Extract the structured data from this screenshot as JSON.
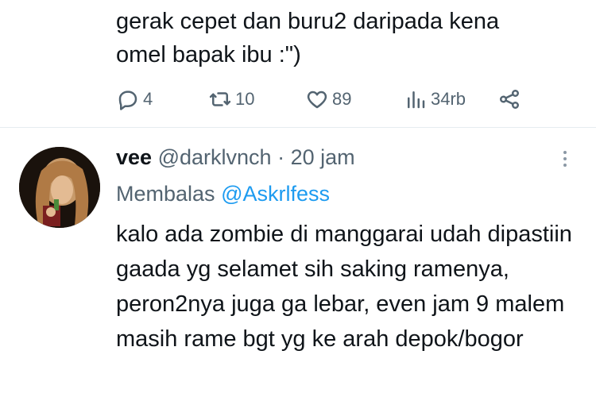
{
  "top_tweet": {
    "text": "gerak cepet dan buru2 daripada kena\nomel bapak ibu :\")",
    "actions": {
      "replies": "4",
      "retweets": "10",
      "likes": "89",
      "views": "34rb"
    },
    "icons": [
      "reply-icon",
      "retweet-icon",
      "like-icon",
      "views-icon",
      "share-icon"
    ]
  },
  "reply_tweet": {
    "display_name": "vee",
    "handle": "@darklvnch",
    "separator": "·",
    "time": "20 jam",
    "replying_label": "Membalas",
    "replying_to": "@Askrlfess",
    "text": "kalo ada zombie di manggarai udah dipastiin gaada yg selamet sih saking ramenya, peron2nya juga ga lebar, even jam 9 malem masih rame bgt yg ke arah depok/bogor"
  },
  "colors": {
    "text": "#0f1419",
    "muted": "#536471",
    "link": "#1d9bf0",
    "divider": "#e6ecf0"
  }
}
